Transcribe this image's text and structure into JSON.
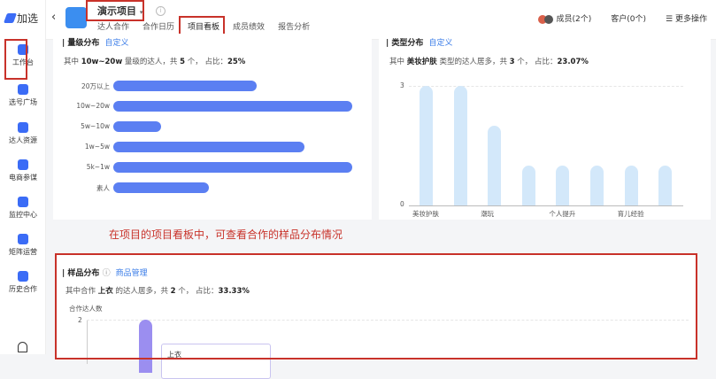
{
  "sidebar": {
    "logo": "加选",
    "items": [
      {
        "label": "工作台",
        "icon": "workbench-icon"
      },
      {
        "label": "选号广场",
        "icon": "user-icon"
      },
      {
        "label": "达人资源",
        "icon": "folder-star-icon"
      },
      {
        "label": "电商参谋",
        "icon": "bag-icon"
      },
      {
        "label": "监控中心",
        "icon": "monitor-icon"
      },
      {
        "label": "矩阵运营",
        "icon": "ai-doc-icon"
      },
      {
        "label": "历史合作",
        "icon": "history-icon"
      }
    ],
    "bell_icon": "bell-icon"
  },
  "header": {
    "title": "演示项目",
    "tabs": [
      "达人合作",
      "合作日历",
      "项目看板",
      "成员绩效",
      "报告分析"
    ],
    "active_tab": 2,
    "members": "成员(2个)",
    "clients": "客户(0个)",
    "more": "更多操作"
  },
  "level": {
    "title": "量级分布",
    "link": "自定义",
    "sub_pre": "其中",
    "sub_key": "10w~20w",
    "sub_mid": "量级的达人，共",
    "sub_count": "5",
    "sub_post": "个， 占比：",
    "sub_pct": "25%"
  },
  "type": {
    "title": "类型分布",
    "link": "自定义",
    "sub_pre": "其中",
    "sub_key": "美妆护肤",
    "sub_mid": "类型的达人居多，共",
    "sub_count": "3",
    "sub_post": "个， 占比：",
    "sub_pct": "23.07%"
  },
  "caption": "在项目的项目看板中，可查看合作的样品分布情况",
  "sample": {
    "title": "样品分布",
    "link": "商品管理",
    "sub_pre": "其中合作",
    "sub_key": "上衣",
    "sub_mid": "的达人居多，共",
    "sub_count": "2",
    "sub_post": "个， 占比：",
    "sub_pct": "33.33%",
    "ylabel": "合作达人数",
    "ytick": "2",
    "tooltip": "上衣"
  },
  "chart_data": [
    {
      "type": "bar",
      "orientation": "horizontal",
      "categories": [
        "20万以上",
        "10w~20w",
        "5w~10w",
        "1w~5w",
        "5k~1w",
        "素人"
      ],
      "values": [
        3,
        5,
        1,
        4,
        5,
        2
      ],
      "color": "#5b7ff2"
    },
    {
      "type": "bar",
      "categories": [
        "美妆护肤",
        "",
        "潮玩",
        "",
        "个人提升",
        "",
        "育儿经验",
        ""
      ],
      "values": [
        3,
        3,
        2,
        1,
        1,
        1,
        1,
        1
      ],
      "yticks": [
        "0",
        "3"
      ],
      "ylim": [
        0,
        3
      ],
      "color": "#d3e8fa"
    },
    {
      "type": "bar",
      "ylabel": "合作达人数",
      "yticks": [
        "2"
      ],
      "values": [
        2
      ],
      "color": "#9b8ef0"
    }
  ]
}
